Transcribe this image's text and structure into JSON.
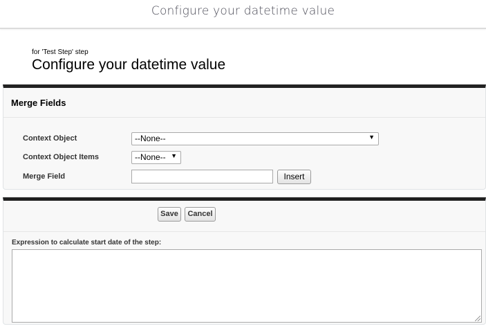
{
  "topbar": {
    "title": "Configure your datetime value"
  },
  "header": {
    "subtitle": "for 'Test Step' step",
    "title": "Configure your datetime value"
  },
  "merge_fields": {
    "title": "Merge Fields",
    "context_object_label": "Context Object",
    "context_object_value": "--None--",
    "context_object_items_label": "Context Object Items",
    "context_object_items_value": "--None--",
    "merge_field_label": "Merge Field",
    "merge_field_value": "",
    "insert_label": "Insert"
  },
  "actions": {
    "save_label": "Save",
    "cancel_label": "Cancel"
  },
  "expression": {
    "label": "Expression to calculate start date of the step:",
    "value": ""
  },
  "icons": {
    "dropdown": "chevron-down-icon",
    "resize": "resize-grip-icon"
  },
  "colors": {
    "panel_top_border": "#222222",
    "panel_background": "#f8f8f8"
  }
}
